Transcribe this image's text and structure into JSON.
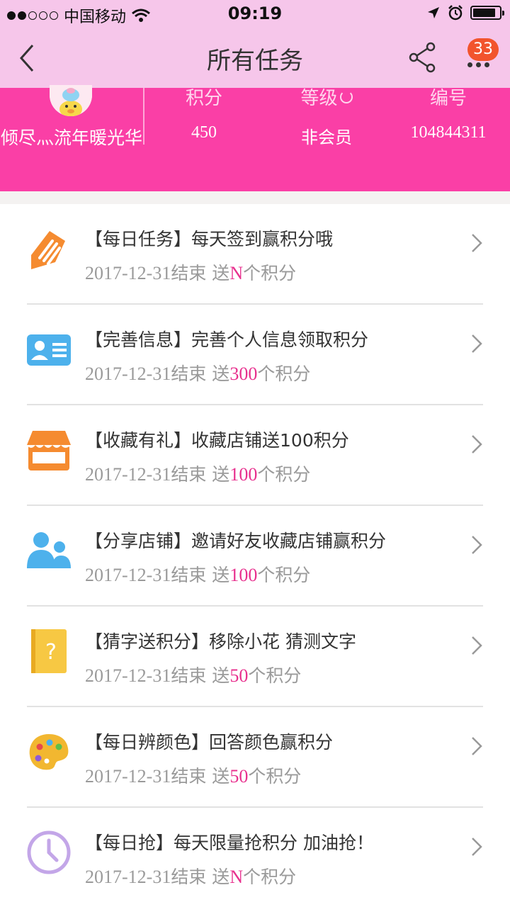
{
  "status_bar": {
    "carrier": "中国移动",
    "time": "09:19",
    "battery_level": 0.85
  },
  "nav": {
    "title": "所有任务",
    "badge_count": "33"
  },
  "profile": {
    "username": "倾尽灬流年暖光华",
    "stats": [
      {
        "label": "积分",
        "value": "450"
      },
      {
        "label": "等级",
        "value": "非会员"
      },
      {
        "label": "编号",
        "value": "104844311"
      }
    ]
  },
  "tasks": [
    {
      "icon": "pencil-tag-icon",
      "title": "【每日任务】每天签到赢积分哦",
      "date": "2017-12-31",
      "end_text": "结束",
      "give": "送",
      "points": "N",
      "unit": "个积分",
      "icon_color": "#f58b30"
    },
    {
      "icon": "id-card-icon",
      "title": "【完善信息】完善个人信息领取积分",
      "date": "2017-12-31",
      "end_text": "结束",
      "give": "送",
      "points": "300",
      "unit": "个积分",
      "icon_color": "#4db1ec"
    },
    {
      "icon": "store-icon",
      "title": "【收藏有礼】收藏店铺送100积分",
      "date": "2017-12-31",
      "end_text": "结束",
      "give": "送",
      "points": "100",
      "unit": "个积分",
      "icon_color": "#f58b30"
    },
    {
      "icon": "people-icon",
      "title": "【分享店铺】邀请好友收藏店铺赢积分",
      "date": "2017-12-31",
      "end_text": "结束",
      "give": "送",
      "points": "100",
      "unit": "个积分",
      "icon_color": "#4db1ec"
    },
    {
      "icon": "question-book-icon",
      "title": "【猜字送积分】移除小花 猜测文字",
      "date": "2017-12-31",
      "end_text": "结束",
      "give": "送",
      "points": "50",
      "unit": "个积分",
      "icon_color": "#f7c843"
    },
    {
      "icon": "palette-icon",
      "title": "【每日辨颜色】回答颜色赢积分",
      "date": "2017-12-31",
      "end_text": "结束",
      "give": "送",
      "points": "50",
      "unit": "个积分",
      "icon_color": "#f2b730"
    },
    {
      "icon": "clock-icon",
      "title": "【每日抢】每天限量抢积分 加油抢！",
      "date": "2017-12-31",
      "end_text": "结束",
      "give": "送",
      "points": "N",
      "unit": "个积分",
      "icon_color": "#c3a6e8"
    }
  ],
  "colors": {
    "header_pink": "#f6c6ea",
    "profile_magenta": "#fa3fa6",
    "points_accent": "#e8308e",
    "badge": "#f2542d"
  }
}
